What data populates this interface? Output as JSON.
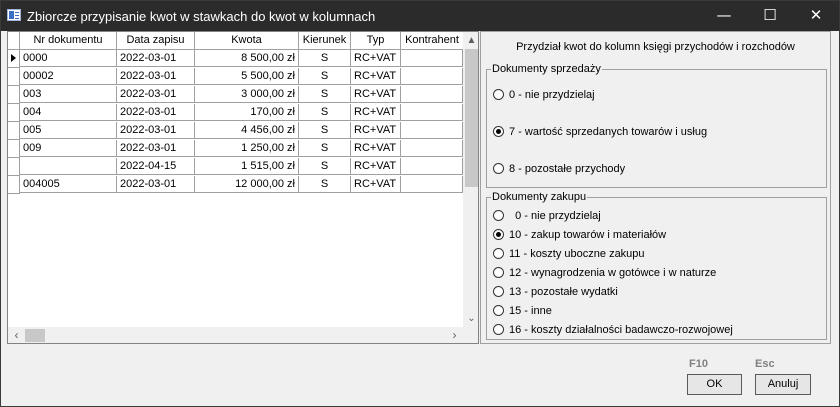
{
  "window": {
    "title": "Zbiorcze przypisanie kwot w stawkach do kwot w kolumnach",
    "minimize": "—",
    "maximize": "☐",
    "close": "✕"
  },
  "grid": {
    "columns": [
      "Nr dokumentu",
      "Data zapisu",
      "Kwota",
      "Kierunek",
      "Typ",
      "Kontrahent"
    ],
    "rows": [
      {
        "nr": "0000",
        "data": "2022-03-01",
        "kwota": "8 500,00 zł",
        "kierunek": "S",
        "typ": "RC+VAT",
        "kontrahent": "",
        "current": true
      },
      {
        "nr": "00002",
        "data": "2022-03-01",
        "kwota": "5 500,00 zł",
        "kierunek": "S",
        "typ": "RC+VAT",
        "kontrahent": ""
      },
      {
        "nr": "003",
        "data": "2022-03-01",
        "kwota": "3 000,00 zł",
        "kierunek": "S",
        "typ": "RC+VAT",
        "kontrahent": ""
      },
      {
        "nr": "004",
        "data": "2022-03-01",
        "kwota": "170,00 zł",
        "kierunek": "S",
        "typ": "RC+VAT",
        "kontrahent": ""
      },
      {
        "nr": "005",
        "data": "2022-03-01",
        "kwota": "4 456,00 zł",
        "kierunek": "S",
        "typ": "RC+VAT",
        "kontrahent": ""
      },
      {
        "nr": "009",
        "data": "2022-03-01",
        "kwota": "1 250,00 zł",
        "kierunek": "S",
        "typ": "RC+VAT",
        "kontrahent": ""
      },
      {
        "nr": "",
        "data": "2022-04-15",
        "kwota": "1 515,00 zł",
        "kierunek": "S",
        "typ": "RC+VAT",
        "kontrahent": ""
      },
      {
        "nr": "004005",
        "data": "2022-03-01",
        "kwota": "12 000,00 zł",
        "kierunek": "S",
        "typ": "RC+VAT",
        "kontrahent": ""
      }
    ],
    "scroll_up": "▲",
    "scroll_down": "⌄",
    "scroll_left": "‹",
    "scroll_right": "›"
  },
  "panel": {
    "title": "Przydział kwot do kolumn księgi przychodów i rozchodów",
    "sales": {
      "legend": "Dokumenty sprzedaży",
      "options": [
        {
          "label": "0 - nie przydzielaj",
          "checked": false
        },
        {
          "label": "7 - wartość sprzedanych towarów i usług",
          "checked": true
        },
        {
          "label": "8 - pozostałe przychody",
          "checked": false
        }
      ]
    },
    "purchase": {
      "legend": "Dokumenty zakupu",
      "options": [
        {
          "label": "  0 - nie przydzielaj",
          "checked": false
        },
        {
          "label": "10 - zakup towarów i materiałów",
          "checked": true
        },
        {
          "label": "11 - koszty uboczne zakupu",
          "checked": false
        },
        {
          "label": "12 - wynagrodzenia w gotówce i w naturze",
          "checked": false
        },
        {
          "label": "13 - pozostałe wydatki",
          "checked": false
        },
        {
          "label": "15 - inne",
          "checked": false
        },
        {
          "label": "16 - koszty działalności badawczo-rozwojowej",
          "checked": false
        }
      ]
    }
  },
  "footer": {
    "ok_hotkey": "F10",
    "cancel_hotkey": "Esc",
    "ok_label": "OK",
    "cancel_label": "Anuluj"
  }
}
